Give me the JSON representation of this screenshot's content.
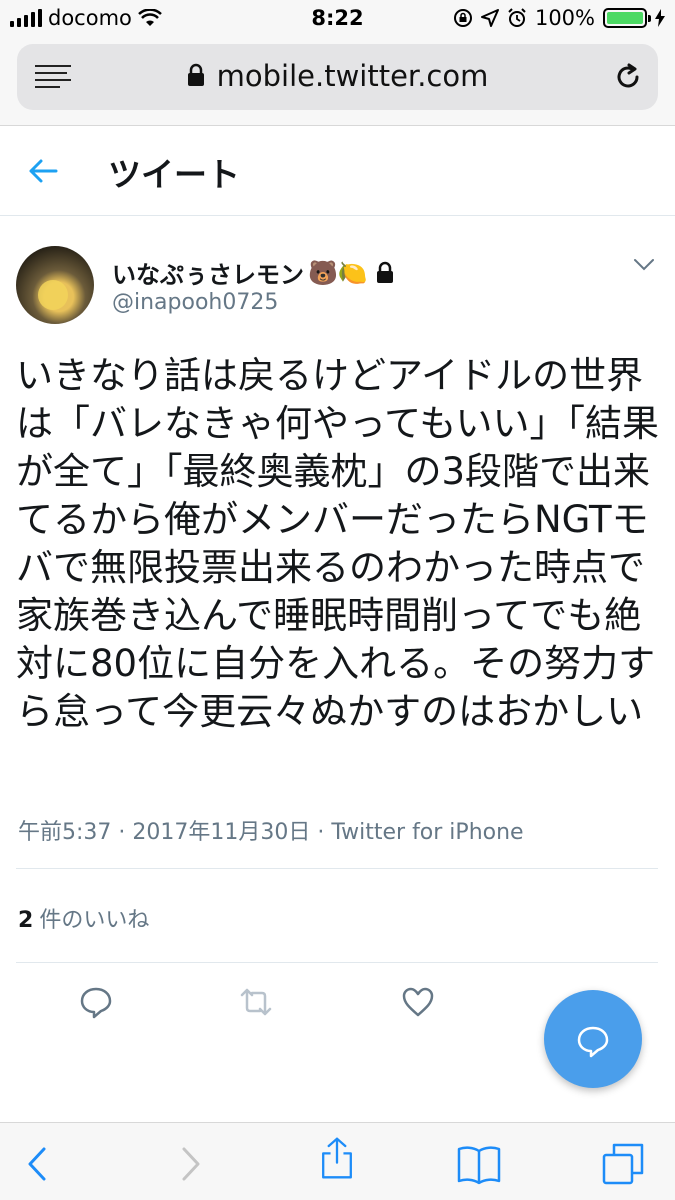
{
  "status_bar": {
    "carrier": "docomo",
    "time": "8:22",
    "battery": "100%"
  },
  "browser": {
    "url": "mobile.twitter.com"
  },
  "header": {
    "title": "ツイート"
  },
  "tweet": {
    "display_name": "いなぷぅさレモン",
    "name_emojis": "🐻🍋",
    "handle": "@inapooh0725",
    "text": "いきなり話は戻るけどアイドルの世界は「バレなきゃ何やってもいい」「結果が全て」「最終奥義枕」の3段階で出来てるから俺がメンバーだったらNGTモバで無限投票出来るのわかった時点で家族巻き込んで睡眠時間削ってでも絶対に80位に自分を入れる。その努力すら怠って今更云々ぬかすのはおかしい",
    "timestamp": "午前5:37 · 2017年11月30日 · Twitter for iPhone",
    "likes_count": "2",
    "likes_label": "件のいいね"
  },
  "colors": {
    "accent": "#1da1f2",
    "fab": "#4a9eeb",
    "secondary_text": "#657786",
    "battery": "#4cd964"
  }
}
